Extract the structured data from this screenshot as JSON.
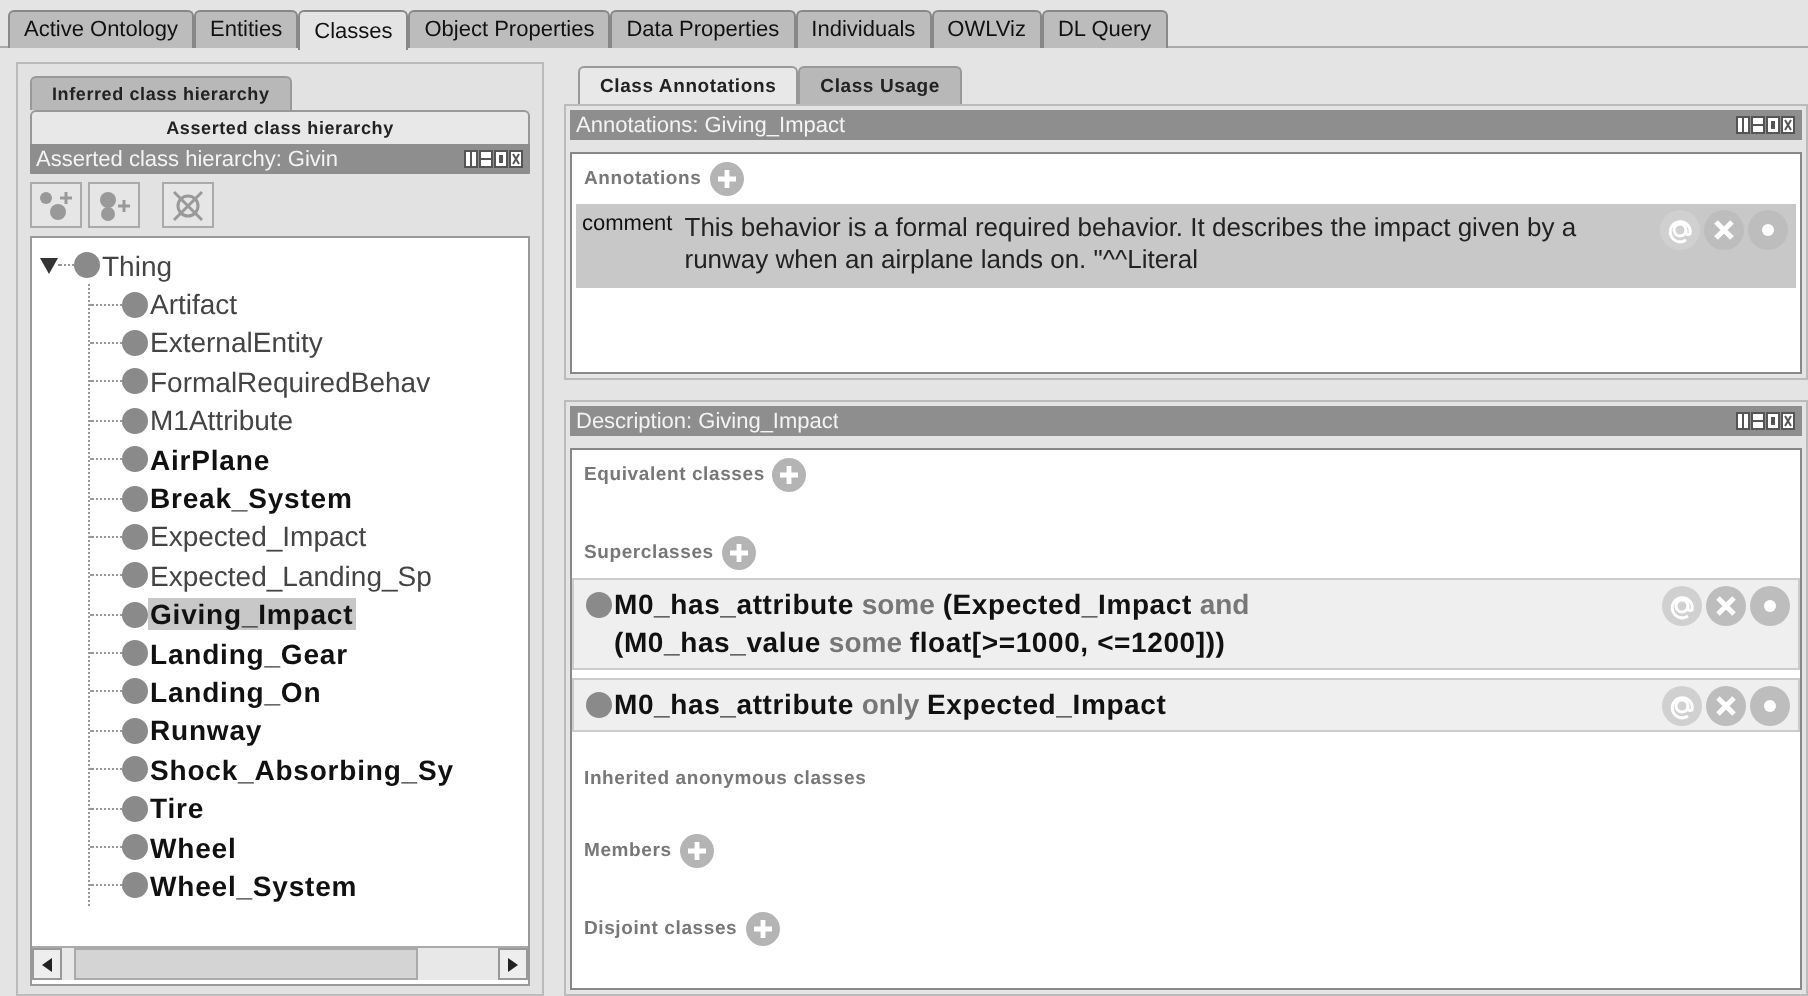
{
  "main_tabs": [
    {
      "label": "Active Ontology",
      "selected": false
    },
    {
      "label": "Entities",
      "selected": false
    },
    {
      "label": "Classes",
      "selected": true
    },
    {
      "label": "Object Properties",
      "selected": false
    },
    {
      "label": "Data Properties",
      "selected": false
    },
    {
      "label": "Individuals",
      "selected": false
    },
    {
      "label": "OWLViz",
      "selected": false
    },
    {
      "label": "DL Query",
      "selected": false
    }
  ],
  "class_hierarchy": {
    "view_tabs": [
      {
        "label": "Inferred class hierarchy",
        "selected": false
      },
      {
        "label": "Asserted class hierarchy",
        "selected": true
      }
    ],
    "title": "Asserted class hierarchy: Givin",
    "tree": [
      {
        "label": "Thing",
        "bold": false,
        "selected": false,
        "expanded": true,
        "children": [
          {
            "label": "Artifact",
            "bold": false,
            "selected": false
          },
          {
            "label": "ExternalEntity",
            "bold": false,
            "selected": false
          },
          {
            "label": "FormalRequiredBehav",
            "bold": false,
            "selected": false
          },
          {
            "label": "M1Attribute",
            "bold": false,
            "selected": false
          },
          {
            "label": "AirPlane",
            "bold": true,
            "selected": false
          },
          {
            "label": "Break_System",
            "bold": true,
            "selected": false
          },
          {
            "label": "Expected_Impact",
            "bold": false,
            "selected": false
          },
          {
            "label": "Expected_Landing_Sp",
            "bold": false,
            "selected": false
          },
          {
            "label": "Giving_Impact",
            "bold": true,
            "selected": true
          },
          {
            "label": "Landing_Gear",
            "bold": true,
            "selected": false
          },
          {
            "label": "Landing_On",
            "bold": true,
            "selected": false
          },
          {
            "label": "Runway",
            "bold": true,
            "selected": false
          },
          {
            "label": "Shock_Absorbing_Sy",
            "bold": true,
            "selected": false
          },
          {
            "label": "Tire",
            "bold": true,
            "selected": false
          },
          {
            "label": "Wheel",
            "bold": true,
            "selected": false
          },
          {
            "label": "Wheel_System",
            "bold": true,
            "selected": false
          }
        ]
      }
    ]
  },
  "class_tabs": [
    {
      "label": "Class Annotations",
      "selected": true
    },
    {
      "label": "Class Usage",
      "selected": false
    }
  ],
  "annotations_panel": {
    "title": "Annotations: Giving_Impact",
    "section": "Annotations",
    "annotations": [
      {
        "property": "comment",
        "value": "This behavior is a formal required behavior. It describes the impact given by a runway when an airplane lands on. \"^^Literal"
      }
    ]
  },
  "description_panel": {
    "title": "Description: Giving_Impact",
    "sections": [
      {
        "label": "Equivalent classes",
        "addable": true
      },
      {
        "label": "Superclasses",
        "addable": true,
        "items": [
          {
            "tokens": [
              {
                "kind": "entity",
                "text": "M0_has_attribute"
              },
              {
                "kind": "keyword",
                "text": "some"
              },
              {
                "kind": "entity",
                "text": "(Expected_Impact"
              },
              {
                "kind": "keyword",
                "text": "and"
              },
              {
                "kind": "entity",
                "text": "(M0_has_value"
              },
              {
                "kind": "keyword",
                "text": "some"
              },
              {
                "kind": "entity",
                "text": "float[>=1000, <=1200]))"
              }
            ]
          },
          {
            "tokens": [
              {
                "kind": "entity",
                "text": "M0_has_attribute"
              },
              {
                "kind": "keyword",
                "text": "only"
              },
              {
                "kind": "entity",
                "text": "Expected_Impact"
              }
            ]
          }
        ]
      },
      {
        "label": "Inherited anonymous classes",
        "addable": false
      },
      {
        "label": "Members",
        "addable": true
      },
      {
        "label": "Disjoint classes",
        "addable": true
      }
    ]
  }
}
